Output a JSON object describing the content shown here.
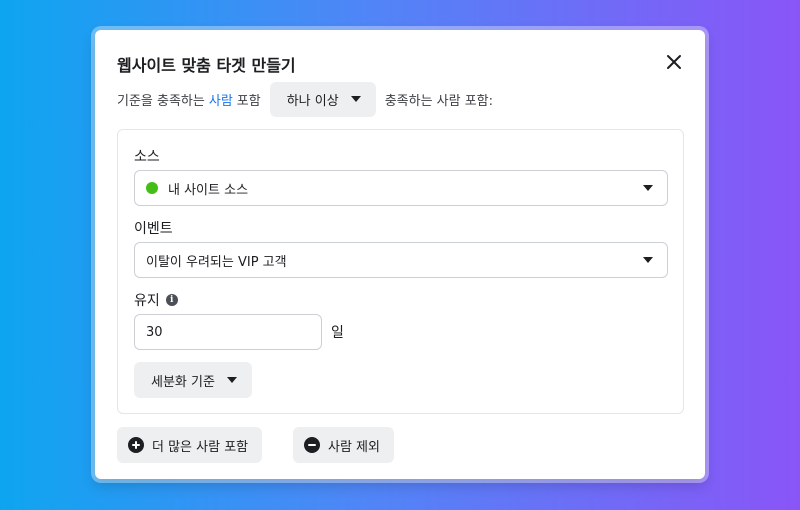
{
  "dialog": {
    "title": "웹사이트 맞춤 타겟 만들기",
    "close_icon": "close-icon"
  },
  "criteria": {
    "prefix": "기준을 충족하는",
    "link": "사람",
    "middle": "포함",
    "match_select": "하나 이상",
    "suffix": "충족하는 사람 포함:"
  },
  "rule": {
    "source_label": "소스",
    "source_value": "내 사이트 소스",
    "source_status_color": "#45bd17",
    "event_label": "이벤트",
    "event_value": "이탈이 우려되는 VIP 고객",
    "retention_label": "유지",
    "retention_info_icon": "info-icon",
    "retention_value": "30",
    "retention_unit": "일",
    "refine_button": "세분화 기준"
  },
  "footer": {
    "include_more": "더 많은 사람 포함",
    "exclude": "사람 제외"
  },
  "colors": {
    "link": "#1877f2",
    "button_bg": "#eeeff1"
  }
}
